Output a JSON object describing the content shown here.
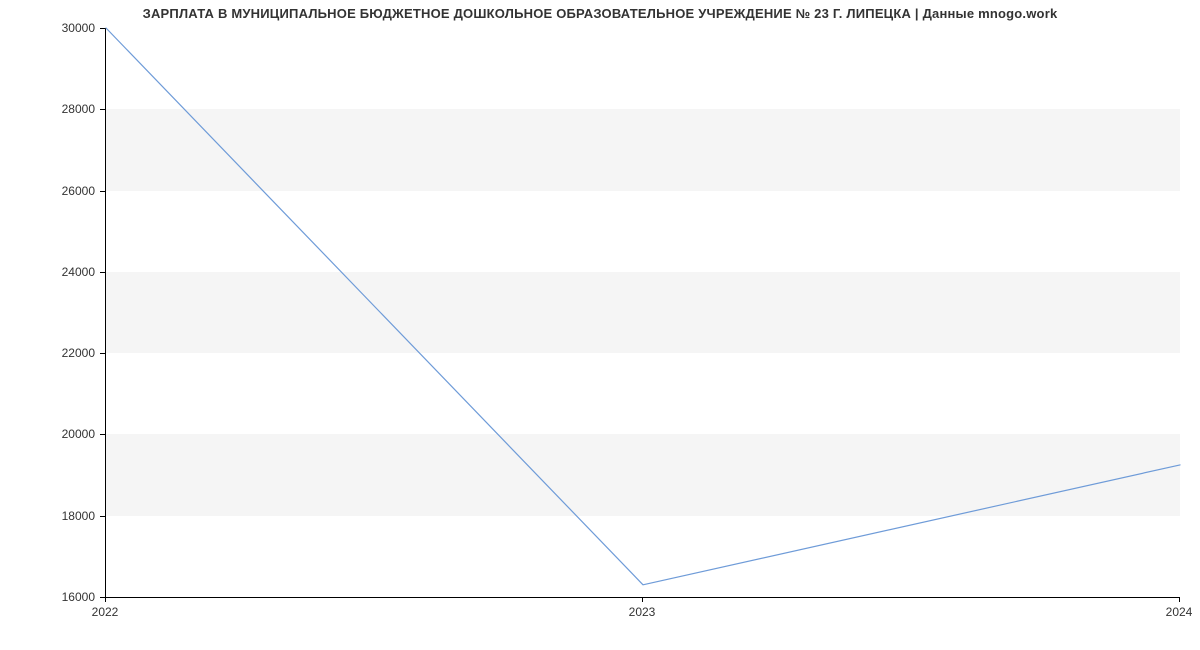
{
  "chart_data": {
    "type": "line",
    "title": "ЗАРПЛАТА В МУНИЦИПАЛЬНОЕ БЮДЖЕТНОЕ ДОШКОЛЬНОЕ ОБРАЗОВАТЕЛЬНОЕ УЧРЕЖДЕНИЕ № 23 Г. ЛИПЕЦКА | Данные mnogo.work",
    "x": [
      2022,
      2023,
      2024
    ],
    "x_ticks": [
      2022,
      2023,
      2024
    ],
    "xlabel": "",
    "ylabel": "",
    "ylim": [
      16000,
      30000
    ],
    "y_ticks": [
      16000,
      18000,
      20000,
      22000,
      24000,
      26000,
      28000,
      30000
    ],
    "series": [
      {
        "name": "salary",
        "color": "#6e9bd8",
        "values": [
          30000,
          16300,
          19250
        ]
      }
    ],
    "grid": {
      "bands": true
    }
  }
}
